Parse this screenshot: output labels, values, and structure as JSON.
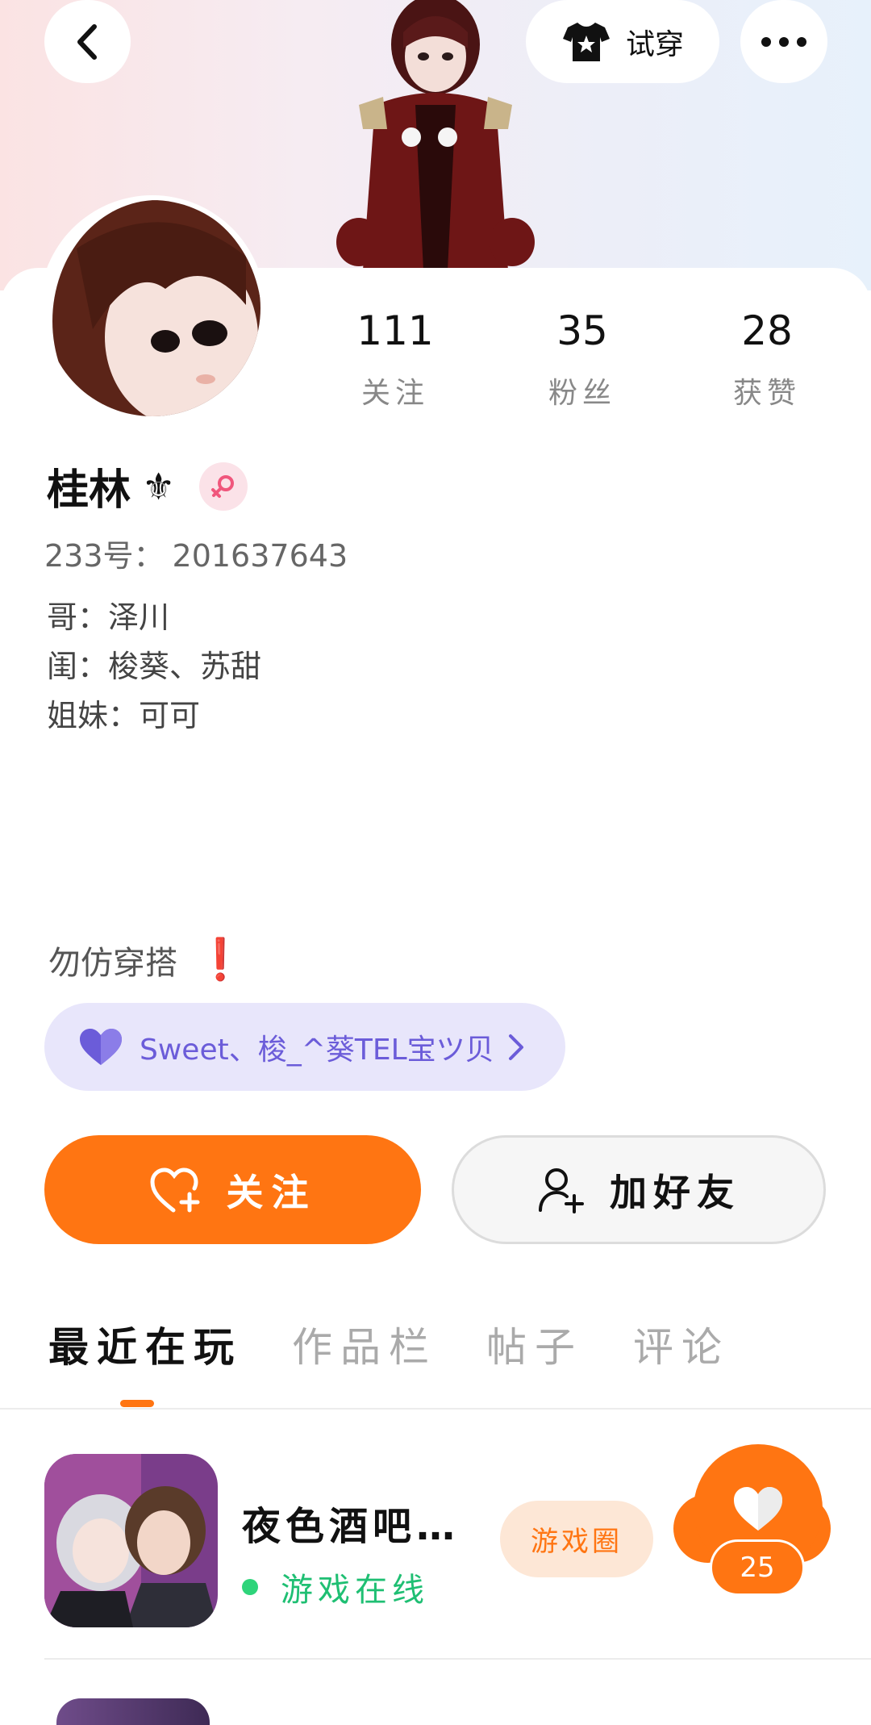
{
  "header": {
    "try_on_label": "试穿"
  },
  "stats": [
    {
      "value": "111",
      "label": "关注"
    },
    {
      "value": "35",
      "label": "粉丝"
    },
    {
      "value": "28",
      "label": "获赞"
    }
  ],
  "profile": {
    "name": "桂林",
    "name_suffix": "⚜",
    "uid_label": "233号：",
    "uid_value": "201637643",
    "bio_lines": [
      "哥：泽川",
      "闺：梭葵、苏甜",
      "姐妹：可可"
    ],
    "notice_text": "勿仿穿搭",
    "notice_mark": "❗"
  },
  "relation": {
    "text": "Sweet、梭_^葵TEL宝ツ贝"
  },
  "actions": {
    "follow_label": "关注",
    "add_friend_label": "加好友"
  },
  "tabs": [
    "最近在玩",
    "作品栏",
    "帖子",
    "评论"
  ],
  "recent_game": {
    "title": "夜色酒吧…",
    "status": "游戏在线",
    "circle_label": "游戏圈",
    "likes": "25"
  },
  "colors": {
    "accent": "#ff7512",
    "online": "#1fbf73",
    "relation_text": "#6b5cd9"
  }
}
